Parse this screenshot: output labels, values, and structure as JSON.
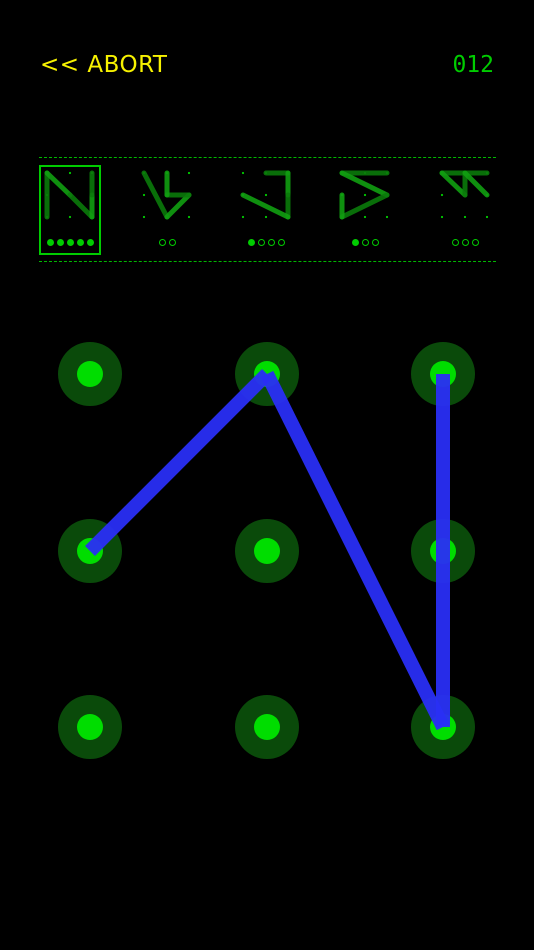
{
  "header": {
    "abort_label": "<< ABORT",
    "counter": "012"
  },
  "colors": {
    "accent_yellow": "#f7f200",
    "green": "#00dd00",
    "green_halo": "#0a4a0a",
    "path_blue": "#2a2ff5"
  },
  "thumbnails": [
    {
      "selected": true,
      "path": [
        6,
        0,
        4,
        8,
        5,
        2
      ],
      "progress": [
        1,
        1,
        1,
        1,
        1
      ]
    },
    {
      "selected": false,
      "path": [
        0,
        7,
        5,
        4,
        1
      ],
      "progress": [
        0,
        0
      ]
    },
    {
      "selected": false,
      "path": [
        1,
        2,
        5,
        8,
        3
      ],
      "progress": [
        1,
        0,
        0,
        0
      ]
    },
    {
      "selected": false,
      "path": [
        2,
        0,
        5,
        6,
        3
      ],
      "progress": [
        1,
        0,
        0
      ]
    },
    {
      "selected": false,
      "path": [
        2,
        0,
        4,
        1,
        5
      ],
      "progress": [
        0,
        0,
        0
      ]
    }
  ],
  "board": {
    "rows": 3,
    "cols": 3,
    "path": [
      3,
      1,
      8,
      2
    ]
  }
}
